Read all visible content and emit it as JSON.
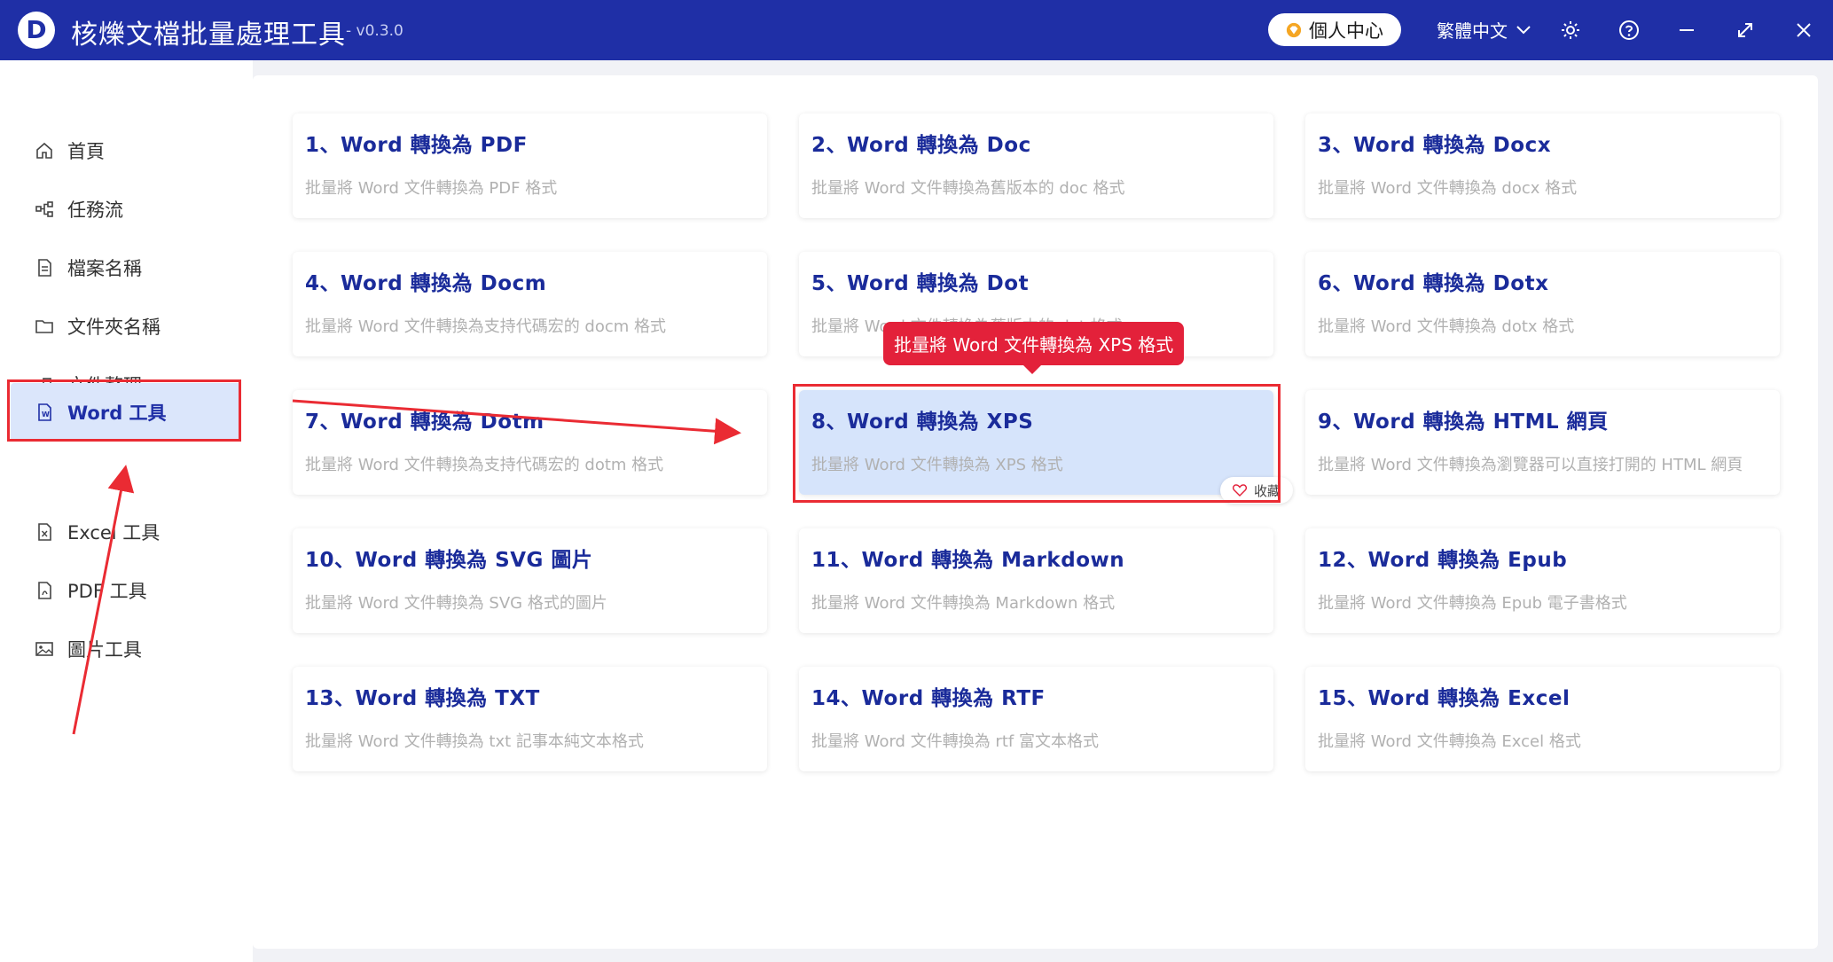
{
  "app": {
    "logo_letter": "D",
    "title": "核爍文檔批量處理工具",
    "version": "- v0.3.0",
    "profile_label": "個人中心",
    "language": "繁體中文"
  },
  "sidebar": {
    "items": [
      {
        "label": "首頁",
        "icon": "home-icon"
      },
      {
        "label": "任務流",
        "icon": "workflow-icon"
      },
      {
        "label": "檔案名稱",
        "icon": "file-name-icon"
      },
      {
        "label": "文件夾名稱",
        "icon": "folder-icon"
      },
      {
        "label": "文件整理",
        "icon": "organize-icon"
      },
      {
        "label": "Word 工具",
        "icon": "word-file-icon",
        "active": true
      },
      {
        "label": "Excel 工具",
        "icon": "excel-file-icon"
      },
      {
        "label": "PDF 工具",
        "icon": "pdf-file-icon"
      },
      {
        "label": "圖片工具",
        "icon": "image-icon"
      }
    ]
  },
  "cards": [
    {
      "title": "1、Word 轉換為 PDF",
      "desc": "批量將 Word 文件轉換為 PDF 格式"
    },
    {
      "title": "2、Word 轉換為 Doc",
      "desc": "批量將 Word 文件轉換為舊版本的 doc 格式"
    },
    {
      "title": "3、Word 轉換為 Docx",
      "desc": "批量將 Word 文件轉換為 docx 格式"
    },
    {
      "title": "4、Word 轉換為 Docm",
      "desc": "批量將 Word 文件轉換為支持代碼宏的 docm 格式"
    },
    {
      "title": "5、Word 轉換為 Dot",
      "desc": "批量將 Word 文件轉換為舊版本的 dot 格式"
    },
    {
      "title": "6、Word 轉換為 Dotx",
      "desc": "批量將 Word 文件轉換為 dotx 格式"
    },
    {
      "title": "7、Word 轉換為 Dotm",
      "desc": "批量將 Word 文件轉換為支持代碼宏的 dotm 格式"
    },
    {
      "title": "8、Word 轉換為 XPS",
      "desc": "批量將 Word 文件轉換為 XPS 格式",
      "highlighted": true
    },
    {
      "title": "9、Word 轉換為 HTML 網頁",
      "desc": "批量將 Word 文件轉換為瀏覽器可以直接打開的 HTML 網頁"
    },
    {
      "title": "10、Word 轉換為 SVG 圖片",
      "desc": "批量將 Word 文件轉換為 SVG 格式的圖片"
    },
    {
      "title": "11、Word 轉換為 Markdown",
      "desc": "批量將 Word 文件轉換為 Markdown 格式"
    },
    {
      "title": "12、Word 轉換為 Epub",
      "desc": "批量將 Word 文件轉換為 Epub 電子書格式"
    },
    {
      "title": "13、Word 轉換為 TXT",
      "desc": "批量將 Word 文件轉換為 txt 記事本純文本格式"
    },
    {
      "title": "14、Word 轉換為 RTF",
      "desc": "批量將 Word 文件轉換為 rtf 富文本格式"
    },
    {
      "title": "15、Word 轉換為 Excel",
      "desc": "批量將 Word 文件轉換為 Excel 格式"
    }
  ],
  "tooltip": "批量將 Word 文件轉換為 XPS 格式",
  "favorite_label": "收藏",
  "colors": {
    "titlebar": "#1f2fa6",
    "accent": "#1a2b9a",
    "annotation": "#ea2b33",
    "highlight": "#d6e4fb"
  }
}
